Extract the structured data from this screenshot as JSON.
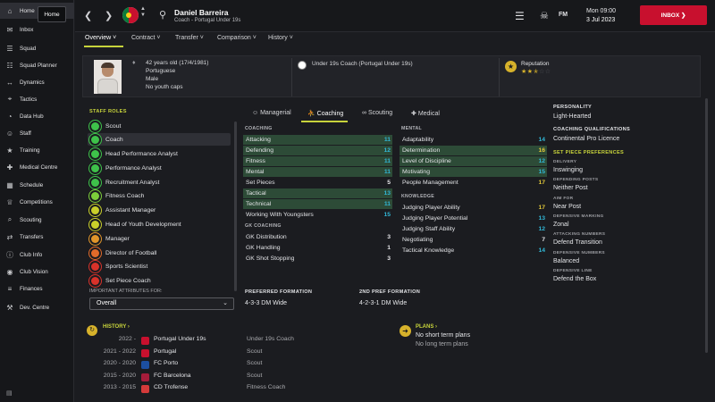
{
  "sidebar": {
    "items": [
      {
        "label": "Home",
        "icon": "home-icon"
      },
      {
        "label": "Inbox",
        "icon": "inbox-icon"
      },
      {
        "label": "Squad",
        "icon": "squad-icon"
      },
      {
        "label": "Squad Planner",
        "icon": "squad-planner-icon"
      },
      {
        "label": "Dynamics",
        "icon": "dynamics-icon"
      },
      {
        "label": "Tactics",
        "icon": "tactics-icon"
      },
      {
        "label": "Data Hub",
        "icon": "data-hub-icon"
      },
      {
        "label": "Staff",
        "icon": "staff-icon"
      },
      {
        "label": "Training",
        "icon": "training-icon"
      },
      {
        "label": "Medical Centre",
        "icon": "medical-icon"
      },
      {
        "label": "Schedule",
        "icon": "schedule-icon"
      },
      {
        "label": "Competitions",
        "icon": "competitions-icon"
      },
      {
        "label": "Scouting",
        "icon": "scouting-icon"
      },
      {
        "label": "Transfers",
        "icon": "transfers-icon"
      },
      {
        "label": "Club Info",
        "icon": "club-info-icon"
      },
      {
        "label": "Club Vision",
        "icon": "club-vision-icon"
      },
      {
        "label": "Finances",
        "icon": "finances-icon"
      },
      {
        "label": "Dev. Centre",
        "icon": "dev-centre-icon"
      }
    ],
    "tooltip": "Home"
  },
  "header": {
    "name": "Daniel Barreira",
    "role": "Coach - Portugal Under 19s",
    "date_day": "Mon 09:00",
    "date": "3 Jul 2023",
    "inbox_label": "INBOX",
    "fm_logo": "FM"
  },
  "subnav": {
    "tabs": [
      "Overview",
      "Contract",
      "Transfer",
      "Comparison",
      "History"
    ]
  },
  "profile": {
    "age": "42 years old (17/4/1981)",
    "nationality": "Portuguese",
    "gender": "Male",
    "caps": "No youth caps",
    "job": "Under 19s Coach (Portugal Under 19s)",
    "reputation_label": "Reputation",
    "reputation_stars": 2.5
  },
  "roles": {
    "title": "STAFF ROLES",
    "items": [
      {
        "label": "Scout",
        "color": "#3ec24a"
      },
      {
        "label": "Coach",
        "color": "#3ec24a"
      },
      {
        "label": "Head Performance Analyst",
        "color": "#3ec24a"
      },
      {
        "label": "Performance Analyst",
        "color": "#3ec24a"
      },
      {
        "label": "Recruitment Analyst",
        "color": "#3ec24a"
      },
      {
        "label": "Fitness Coach",
        "color": "#7ccf3a"
      },
      {
        "label": "Assistant Manager",
        "color": "#c9cf2a"
      },
      {
        "label": "Head of Youth Development",
        "color": "#c9cf2a"
      },
      {
        "label": "Manager",
        "color": "#e0952a"
      },
      {
        "label": "Director of Football",
        "color": "#e06a2a"
      },
      {
        "label": "Sports Scientist",
        "color": "#d8322a"
      },
      {
        "label": "Set Piece Coach",
        "color": "#d8322a"
      }
    ],
    "attrs_label": "IMPORTANT ATTRIBUTES FOR:",
    "attrs_value": "Overall"
  },
  "attr_tabs": [
    "Managerial",
    "Coaching",
    "Scouting",
    "Medical"
  ],
  "coaching": {
    "title": "COACHING",
    "items": [
      {
        "name": "Attacking",
        "value": 11,
        "hl": true
      },
      {
        "name": "Defending",
        "value": 12,
        "hl": true
      },
      {
        "name": "Fitness",
        "value": 11,
        "hl": true
      },
      {
        "name": "Mental",
        "value": 11,
        "hl": true
      },
      {
        "name": "Set Pieces",
        "value": 5,
        "hl": false
      },
      {
        "name": "Tactical",
        "value": 13,
        "hl": true
      },
      {
        "name": "Technical",
        "value": 11,
        "hl": true
      },
      {
        "name": "Working With Youngsters",
        "value": 15,
        "hl": false
      }
    ]
  },
  "gk": {
    "title": "GK COACHING",
    "items": [
      {
        "name": "GK Distribution",
        "value": 3
      },
      {
        "name": "GK Handling",
        "value": 1
      },
      {
        "name": "GK Shot Stopping",
        "value": 3
      }
    ]
  },
  "mental": {
    "title": "MENTAL",
    "items": [
      {
        "name": "Adaptability",
        "value": 14,
        "hl": false
      },
      {
        "name": "Determination",
        "value": 16,
        "hl": true
      },
      {
        "name": "Level of Discipline",
        "value": 12,
        "hl": true
      },
      {
        "name": "Motivating",
        "value": 15,
        "hl": true
      },
      {
        "name": "People Management",
        "value": 17,
        "hl": false
      }
    ]
  },
  "knowledge": {
    "title": "KNOWLEDGE",
    "items": [
      {
        "name": "Judging Player Ability",
        "value": 17
      },
      {
        "name": "Judging Player Potential",
        "value": 13
      },
      {
        "name": "Judging Staff Ability",
        "value": 12
      },
      {
        "name": "Negotiating",
        "value": 7
      },
      {
        "name": "Tactical Knowledge",
        "value": 14
      }
    ]
  },
  "formation": {
    "pref_title": "PREFERRED FORMATION",
    "pref_value": "4-3-3 DM Wide",
    "second_title": "2ND PREF FORMATION",
    "second_value": "4-2-3-1 DM Wide"
  },
  "right_info": {
    "personality_title": "PERSONALITY",
    "personality": "Light-Hearted",
    "quals_title": "COACHING QUALIFICATIONS",
    "quals": "Continental Pro Licence",
    "setpiece_title": "SET PIECE PREFERENCES",
    "prefs": [
      {
        "label": "DELIVERY",
        "value": "Inswinging"
      },
      {
        "label": "DEFENDING POSTS",
        "value": "Neither Post"
      },
      {
        "label": "AIM FOR",
        "value": "Near Post"
      },
      {
        "label": "DEFENSIVE MARKING",
        "value": "Zonal"
      },
      {
        "label": "ATTACKING NUMBERS",
        "value": "Defend Transition"
      },
      {
        "label": "DEFENSIVE NUMBERS",
        "value": "Balanced"
      },
      {
        "label": "DEFENSIVE LINE",
        "value": "Defend the Box"
      }
    ]
  },
  "history": {
    "title": "HISTORY",
    "rows": [
      {
        "years": "2022 -",
        "club": "Portugal Under 19s",
        "role": "Under 19s Coach",
        "color": "#c8102e"
      },
      {
        "years": "2021 - 2022",
        "club": "Portugal",
        "role": "Scout",
        "color": "#c8102e"
      },
      {
        "years": "2020 - 2020",
        "club": "FC Porto",
        "role": "Scout",
        "color": "#1c4fa0"
      },
      {
        "years": "2015 - 2020",
        "club": "FC Barcelona",
        "role": "Scout",
        "color": "#a51c3a"
      },
      {
        "years": "2013 - 2015",
        "club": "CD Trofense",
        "role": "Fitness Coach",
        "color": "#d43a3a"
      }
    ]
  },
  "plans": {
    "title": "PLANS",
    "short": "No short term plans",
    "long": "No long term plans"
  }
}
